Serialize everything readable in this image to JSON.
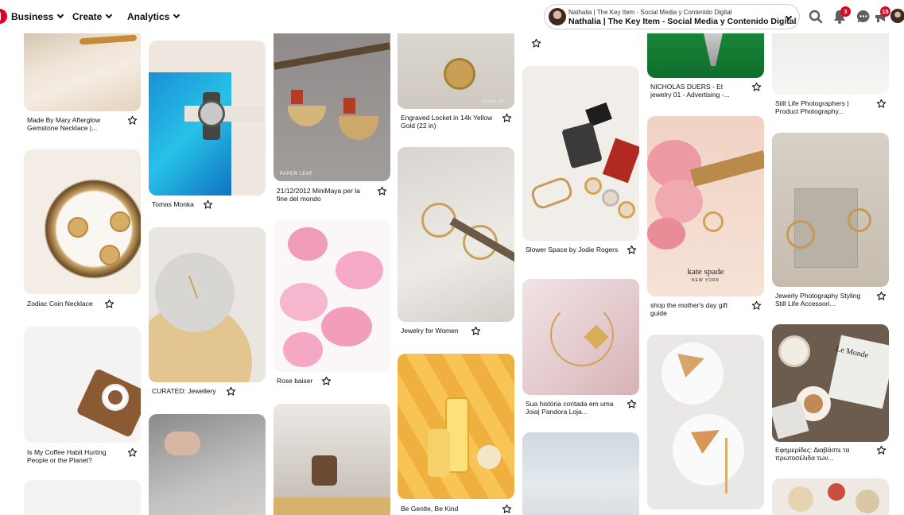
{
  "header": {
    "nav": [
      {
        "label": "Business"
      },
      {
        "label": "Create"
      },
      {
        "label": "Analytics"
      }
    ],
    "account": {
      "line1": "Nathalia | The Key Item - Social Media y Contenido Digital",
      "line2": "Nathalia | The Key Item - Social Media y Contenido Digital"
    },
    "notifications_badge": "3",
    "updates_badge": "15"
  },
  "pins": {
    "c0": [
      {
        "caption": "Made By Mary Afterglow Gemstone Necklace |..."
      },
      {
        "caption": "Zodiac Coin Necklace"
      },
      {
        "caption": "Is My Coffee Habit Hurting People or the Planet?"
      }
    ],
    "c1": [
      {
        "caption": "Tomas Monka"
      },
      {
        "caption": "CURATED: Jewellery"
      }
    ],
    "c2": [
      {
        "caption": "21/12/2012 MiniMaya per la fine del mondo",
        "watermark": "PAPER LEAF"
      },
      {
        "caption": "Rose baiser"
      }
    ],
    "c3": [
      {
        "caption": "Engraved Locket in 14k Yellow Gold (22 in)",
        "watermark": "Share Co."
      },
      {
        "caption": "Jewelry for Women"
      },
      {
        "caption": "Be Gentle, Be Kind"
      }
    ],
    "c4": [
      {
        "caption": "Slower Space by Jodie Rogers"
      },
      {
        "caption": "Sua história contada em uma Joia| Pandora Loja..."
      }
    ],
    "c5": [
      {
        "caption": "NICHOLAS DUERS - Et jewelry 01 - Advertising -..."
      },
      {
        "caption": "shop the mother's day gift guide",
        "brand": "kate spade",
        "brand_sub": "NEW YORK"
      }
    ],
    "c6": [
      {
        "caption": "Still Life Photographers | Product Photography..."
      },
      {
        "caption": "Jewerly Photography Styling Still Life Accessori..."
      },
      {
        "caption": "Εφημερίδες: Διαβάστε τα πρωτοσέλιδα των...",
        "newspaper": "Le Monde"
      }
    ]
  },
  "colors": {
    "accent": "#e60023"
  }
}
